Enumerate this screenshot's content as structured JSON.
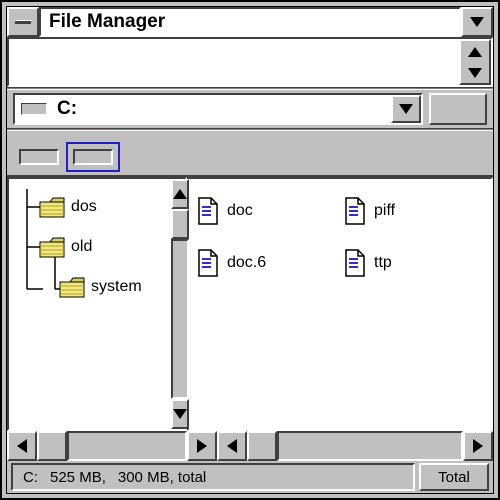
{
  "window": {
    "title": "File Manager"
  },
  "drive": {
    "current": "C:"
  },
  "tree": {
    "items": [
      "dos",
      "old",
      "system"
    ]
  },
  "files": {
    "items": [
      "doc",
      "piff",
      "doc.6",
      "ttp"
    ]
  },
  "status": {
    "prefix": "C:",
    "val1": "525 MB,",
    "val2": "300 MB, total",
    "button": "Total"
  }
}
